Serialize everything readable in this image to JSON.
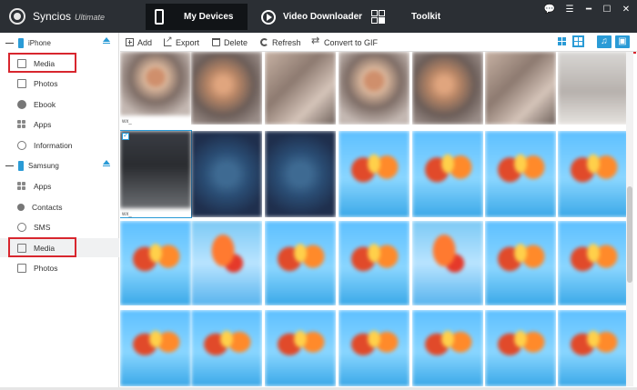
{
  "app": {
    "name": "Syncios",
    "edition": "Ultimate"
  },
  "nav": {
    "tabs": [
      {
        "label": "My Devices",
        "icon": "phone-icon",
        "active": true
      },
      {
        "label": "Video Downloader",
        "icon": "play-icon",
        "active": false
      },
      {
        "label": "Toolkit",
        "icon": "grid-icon",
        "active": false
      }
    ]
  },
  "window_controls": {
    "chat": "💬",
    "menu": "☰",
    "minimize": "━",
    "maximize": "☐",
    "close": "✕"
  },
  "sidebar": {
    "devices": [
      {
        "name": "iPhone",
        "items": [
          {
            "label": "Media",
            "icon": "media-icon",
            "highlighted": true
          },
          {
            "label": "Photos",
            "icon": "photos-icon"
          },
          {
            "label": "Ebook",
            "icon": "ebook-icon"
          },
          {
            "label": "Apps",
            "icon": "apps-icon"
          },
          {
            "label": "Information",
            "icon": "information-icon"
          }
        ]
      },
      {
        "name": "Samsung",
        "items": [
          {
            "label": "Apps",
            "icon": "apps-icon"
          },
          {
            "label": "Contacts",
            "icon": "contacts-icon"
          },
          {
            "label": "SMS",
            "icon": "sms-icon"
          },
          {
            "label": "Media",
            "icon": "media-icon",
            "highlighted": true,
            "active": true
          },
          {
            "label": "Photos",
            "icon": "photos-icon"
          }
        ]
      }
    ]
  },
  "toolbar": {
    "add": "Add",
    "export": "Export",
    "delete": "Delete",
    "refresh": "Refresh",
    "convert": "Convert to GIF"
  },
  "view_modes": [
    "list-view-icon",
    "grid-view-icon"
  ],
  "media_categories": {
    "music": "♫",
    "video": "▣"
  },
  "thumbnails": {
    "filename_prefix": "wx_",
    "rows": [
      [
        "photo",
        "photo2",
        "photo3",
        "photo",
        "photo2",
        "photo3",
        "pale",
        "dark"
      ],
      [
        "dark",
        "dark2",
        "dark2",
        "art",
        "art",
        "art",
        "art",
        "art"
      ],
      [
        "art",
        "art2",
        "art",
        "art",
        "art2",
        "art",
        "art",
        "art"
      ],
      [
        "art",
        "art",
        "art",
        "art",
        "art",
        "art",
        "art",
        "art"
      ]
    ]
  },
  "colors": {
    "titlebar": "#2b2f34",
    "accent": "#2a9bd6",
    "highlight_box": "#d8262e"
  }
}
